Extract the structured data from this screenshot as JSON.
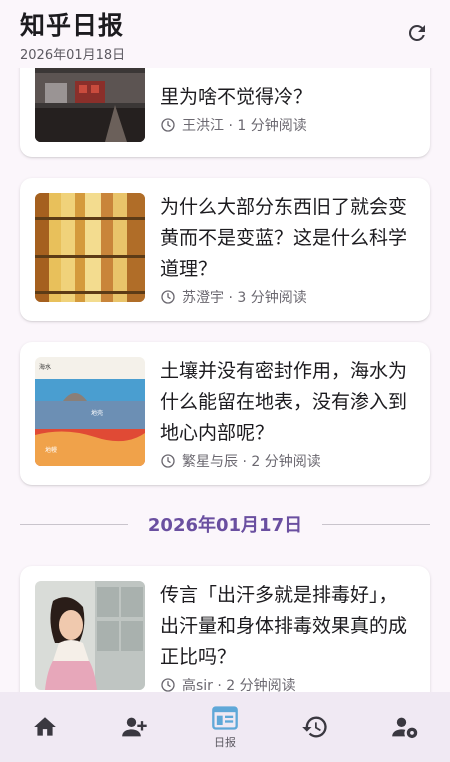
{
  "header": {
    "title": "知乎日报",
    "date": "2026年01月18日"
  },
  "articles": [
    {
      "title": "里为啥不觉得冷？",
      "meta": "王洪江 · 1 分钟阅读",
      "thumb_icon": "winter-scene-photo"
    },
    {
      "title": "为什么大部分东西旧了就会变黄而不是变蓝？这是什么科学道理？",
      "meta": "苏澄宇 · 3 分钟阅读",
      "thumb_icon": "yellowed-books-photo"
    },
    {
      "title": "土壤并没有密封作用，海水为什么能留在地表，没有渗入到地心内部呢？",
      "meta": "繁星与辰 · 2 分钟阅读",
      "thumb_icon": "earth-crust-diagram",
      "thumb_labels": [
        "海水",
        "地壳",
        "地幔"
      ]
    },
    {
      "title": "传言「出汗多就是排毒好」，出汗量和身体排毒效果真的成正比吗？",
      "meta": "高sir · 2 分钟阅读",
      "thumb_icon": "sweating-woman-photo"
    }
  ],
  "date_separator": "2026年01月17日",
  "nav": {
    "items": [
      {
        "icon": "home-icon",
        "label": ""
      },
      {
        "icon": "add-person-icon",
        "label": ""
      },
      {
        "icon": "daily-icon",
        "label": "日报",
        "active": true
      },
      {
        "icon": "history-icon",
        "label": ""
      },
      {
        "icon": "user-settings-icon",
        "label": ""
      }
    ]
  },
  "colors": {
    "background": "#fbf6fb",
    "accent": "#6a4fa0",
    "active_nav": "#5fa8d8",
    "nav_bg": "#f0e9f3"
  }
}
